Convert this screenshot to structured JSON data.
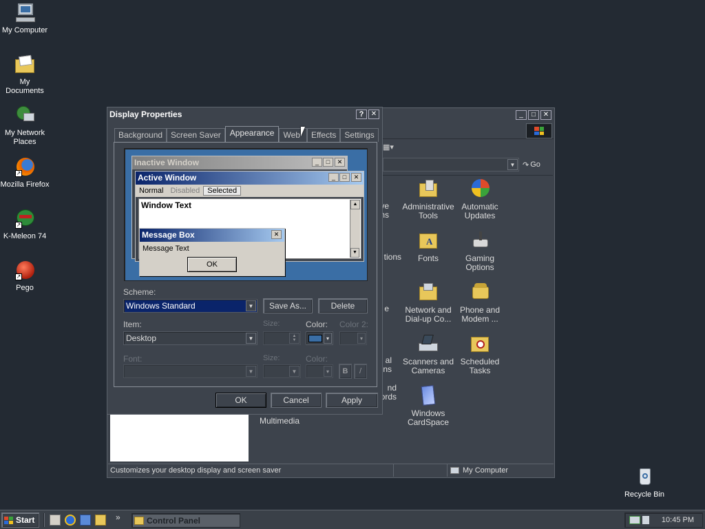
{
  "desktop": {
    "icons": [
      {
        "label": "My Computer",
        "icon": "computer-icon"
      },
      {
        "label": "My Documents",
        "icon": "folder-documents-icon"
      },
      {
        "label": "My Network Places",
        "icon": "network-icon"
      },
      {
        "label": "Mozilla Firefox",
        "icon": "firefox-icon"
      },
      {
        "label": "K-Meleon 74",
        "icon": "kmeleon-icon"
      },
      {
        "label": "Pego",
        "icon": "pego-icon"
      },
      {
        "label": "Recycle Bin",
        "icon": "recycle-bin-icon"
      }
    ]
  },
  "display_properties": {
    "title": "Display Properties",
    "help": "?",
    "close": "✕",
    "tabs": [
      "Background",
      "Screen Saver",
      "Appearance",
      "Web",
      "Effects",
      "Settings"
    ],
    "active_tab": "Appearance",
    "preview": {
      "inactive_title": "Inactive Window",
      "active_title": "Active Window",
      "menu": {
        "normal": "Normal",
        "disabled": "Disabled",
        "selected": "Selected"
      },
      "window_text": "Window Text",
      "msgbox_title": "Message Box",
      "msgbox_text": "Message Text",
      "msgbox_ok": "OK"
    },
    "scheme_label": "Scheme:",
    "scheme_value": "Windows Standard",
    "save_as": "Save As...",
    "delete": "Delete",
    "item_label": "Item:",
    "item_value": "Desktop",
    "size_label": "Size:",
    "color_label": "Color:",
    "color2_label": "Color 2:",
    "font_label": "Font:",
    "font_size_label": "Size:",
    "font_color_label": "Color:",
    "bold": "B",
    "italic": "/",
    "ok": "OK",
    "cancel": "Cancel",
    "apply": "Apply",
    "accent": "#0a246a",
    "preview_desktop": "#3a6ea5"
  },
  "control_panel": {
    "title": "Control Panel",
    "go": "Go",
    "items": [
      {
        "label": "Add or Remove Programs",
        "shown": "ove ms"
      },
      {
        "label": "Administrative Tools"
      },
      {
        "label": "Automatic Updates"
      },
      {
        "label": "Fonts"
      },
      {
        "label": "Gaming Options"
      },
      {
        "label": "Network and Dial-up Co..."
      },
      {
        "label": "Phone and Modem ..."
      },
      {
        "label": "Scanners and Cameras"
      },
      {
        "label": "Scheduled Tasks"
      },
      {
        "label": "Windows CardSpace"
      },
      {
        "label": "Multimedia"
      },
      {
        "label": "Passwords"
      }
    ],
    "partial_labels": {
      "r1": "ove",
      "r1b": "ms",
      "r2": "tions",
      "r3": "e",
      "r4a": "al",
      "r4b": "ns",
      "r5a": "nd",
      "r5b": "Passwords",
      "multimedia": "Multimedia"
    },
    "status_text": "Customizes your desktop display and screen saver",
    "status_zone": "My Computer"
  },
  "taskbar": {
    "start": "Start",
    "task": "Control Panel",
    "clock": "10:45 PM",
    "more": "»"
  }
}
